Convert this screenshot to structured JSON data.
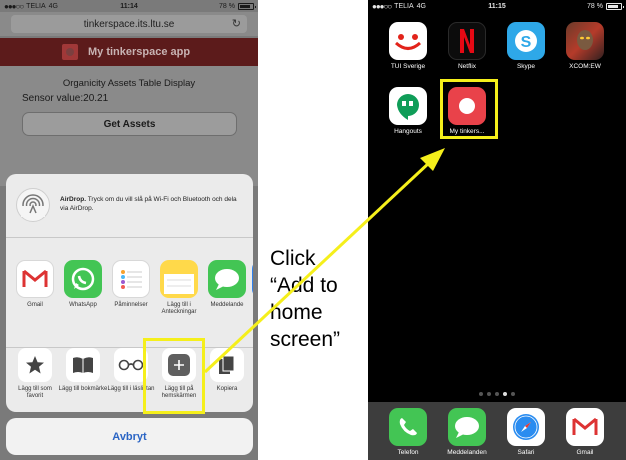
{
  "left_phone": {
    "status": {
      "carrier": "TELIA",
      "network": "4G",
      "time": "11:14",
      "battery": "78 %"
    },
    "url": "tinkerspace.its.ltu.se",
    "app_title": "My tinkerspace app",
    "page": {
      "title": "Organicity Assets Table Display",
      "sensor": "Sensor value:20.21",
      "button": "Get Assets"
    },
    "share_sheet": {
      "airdrop_title": "AirDrop.",
      "airdrop_text": " Tryck om du vill slå på Wi-Fi och Bluetooth och dela via AirDrop.",
      "apps": [
        {
          "label": "Gmail",
          "icon": "gmail-icon"
        },
        {
          "label": "WhatsApp",
          "icon": "whatsapp-icon"
        },
        {
          "label": "Påminnelser",
          "icon": "reminders-icon"
        },
        {
          "label": "Lägg till i Anteckningar",
          "icon": "notes-icon"
        },
        {
          "label": "Meddelande",
          "icon": "messages-icon"
        }
      ],
      "actions": [
        {
          "label": "Lägg till som favorit",
          "icon": "star-icon"
        },
        {
          "label": "Lägg till bokmärke",
          "icon": "book-icon"
        },
        {
          "label": "Lägg till i läslistan",
          "icon": "glasses-icon"
        },
        {
          "label": "Lägg till på hemskärmen",
          "icon": "plus-icon"
        },
        {
          "label": "Kopiera",
          "icon": "copy-icon"
        }
      ],
      "cancel": "Avbryt"
    }
  },
  "annotation": {
    "line1": "Click",
    "line2": "“Add to",
    "line3": "home",
    "line4": "screen”"
  },
  "right_phone": {
    "status": {
      "carrier": "TELIA",
      "network": "4G",
      "time": "11:15",
      "battery": "78 %"
    },
    "apps": [
      {
        "label": "TUI Sverige",
        "icon": "tui-icon"
      },
      {
        "label": "Netflix",
        "icon": "netflix-icon"
      },
      {
        "label": "Skype",
        "icon": "skype-icon"
      },
      {
        "label": "XCOM:EW",
        "icon": "xcom-icon"
      },
      {
        "label": "Hangouts",
        "icon": "hangouts-icon"
      },
      {
        "label": "My tinkers...",
        "icon": "tinkerspace-icon"
      }
    ],
    "dock": [
      {
        "label": "Telefon",
        "icon": "phone-icon"
      },
      {
        "label": "Meddelanden",
        "icon": "messages-icon"
      },
      {
        "label": "Safari",
        "icon": "safari-icon"
      },
      {
        "label": "Gmail",
        "icon": "gmail-icon"
      }
    ]
  },
  "colors": {
    "highlight": "#f5ef1b",
    "arrow": "#f5ef1b",
    "cancel_text": "#2a64c4",
    "app_header": "#5c1b1b"
  }
}
